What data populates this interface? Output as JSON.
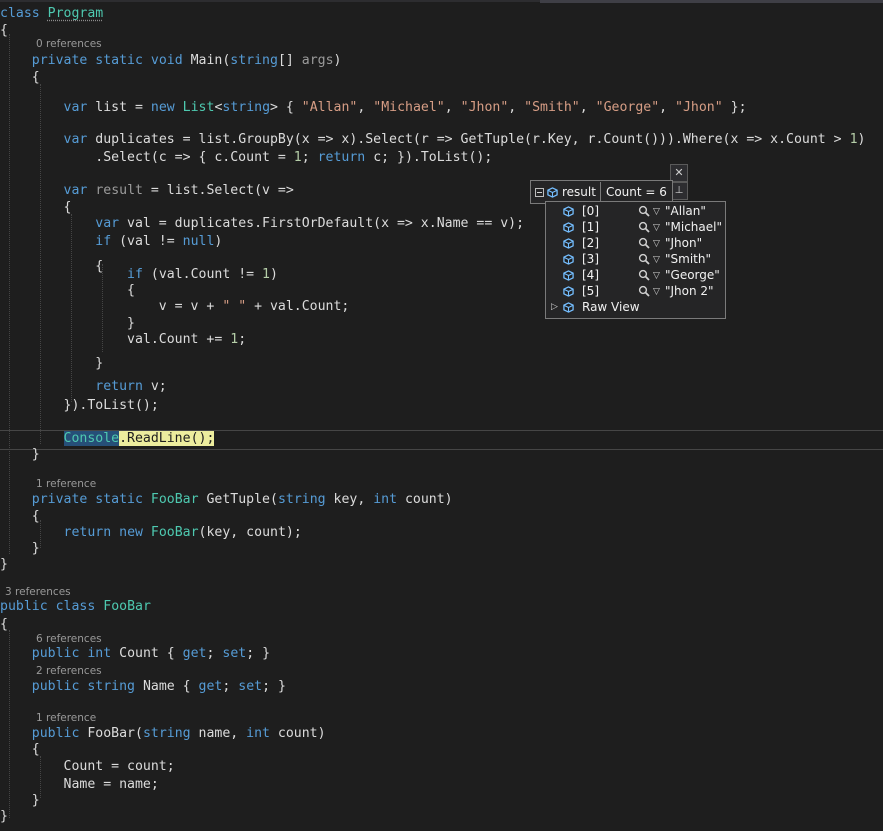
{
  "editor": {
    "lines": [
      {
        "segs": [
          [
            "kw",
            "class"
          ],
          [
            "",
            ""
          ],
          [
            "ty u-prog",
            "Program"
          ]
        ]
      },
      {
        "segs": [
          [
            "",
            "{"
          ]
        ]
      },
      {
        "segs": [
          [
            "",
            "    "
          ],
          [
            "kw",
            "private"
          ],
          [
            "",
            " "
          ],
          [
            "kw",
            "static"
          ],
          [
            "",
            " "
          ],
          [
            "kw",
            "void"
          ],
          [
            "",
            " Main("
          ],
          [
            "kw",
            "string"
          ],
          [
            "",
            "[] "
          ],
          [
            "gray",
            "args"
          ],
          [
            "",
            ")"
          ]
        ]
      },
      {
        "segs": [
          [
            "",
            "    {"
          ]
        ]
      },
      {
        "segs": [
          [
            "",
            "        "
          ],
          [
            "kw",
            "var"
          ],
          [
            "",
            " list = "
          ],
          [
            "kw",
            "new"
          ],
          [
            "",
            " "
          ],
          [
            "ty",
            "List"
          ],
          [
            "",
            "<"
          ],
          [
            "kw",
            "string"
          ],
          [
            "",
            "> { "
          ],
          [
            "st",
            "\"Allan\""
          ],
          [
            "",
            ", "
          ],
          [
            "st",
            "\"Michael\""
          ],
          [
            "",
            ", "
          ],
          [
            "st",
            "\"Jhon\""
          ],
          [
            "",
            ", "
          ],
          [
            "st",
            "\"Smith\""
          ],
          [
            "",
            ", "
          ],
          [
            "st",
            "\"George\""
          ],
          [
            "",
            ", "
          ],
          [
            "st",
            "\"Jhon\""
          ],
          [
            "",
            " };"
          ]
        ]
      },
      {
        "segs": [
          [
            "",
            "        "
          ],
          [
            "kw",
            "var"
          ],
          [
            "",
            " duplicates = list.GroupBy(x => x).Select(r => GetTuple(r.Key, r.Count())).Where(x => x.Count > "
          ],
          [
            "nu",
            "1"
          ],
          [
            "",
            ")"
          ]
        ]
      },
      {
        "segs": [
          [
            "",
            "            .Select(c => { c.Count = "
          ],
          [
            "nu",
            "1"
          ],
          [
            "",
            "; "
          ],
          [
            "kw",
            "return"
          ],
          [
            "",
            " c; }).ToList();"
          ]
        ]
      },
      {
        "segs": [
          [
            "",
            "        "
          ],
          [
            "kw",
            "var"
          ],
          [
            "",
            " "
          ],
          [
            "gray",
            "result"
          ],
          [
            "",
            " = list.Select(v =>"
          ]
        ]
      },
      {
        "segs": [
          [
            "",
            "        {"
          ]
        ]
      },
      {
        "segs": [
          [
            "",
            "            "
          ],
          [
            "kw",
            "var"
          ],
          [
            "",
            " val = duplicates.FirstOrDefault(x => x.Name == v);"
          ]
        ]
      },
      {
        "segs": [
          [
            "",
            "            "
          ],
          [
            "kw",
            "if"
          ],
          [
            "",
            " (val != "
          ],
          [
            "kw",
            "null"
          ],
          [
            "",
            ")"
          ]
        ]
      },
      {
        "segs": [
          [
            "",
            "            {"
          ]
        ]
      },
      {
        "segs": [
          [
            "",
            "                "
          ],
          [
            "kw",
            "if"
          ],
          [
            "",
            " (val.Count != "
          ],
          [
            "nu",
            "1"
          ],
          [
            "",
            ")"
          ]
        ]
      },
      {
        "segs": [
          [
            "",
            "                {"
          ]
        ]
      },
      {
        "segs": [
          [
            "",
            "                    v = v + "
          ],
          [
            "st",
            "\" \""
          ],
          [
            "",
            " + val.Count;"
          ]
        ]
      },
      {
        "segs": [
          [
            "",
            "                }"
          ]
        ]
      },
      {
        "segs": [
          [
            "",
            "                val.Count += "
          ],
          [
            "nu",
            "1"
          ],
          [
            "",
            ";"
          ]
        ]
      },
      {
        "segs": [
          [
            "",
            "            }"
          ]
        ]
      },
      {
        "segs": [
          [
            "",
            "            "
          ],
          [
            "kw",
            "return"
          ],
          [
            "",
            " v;"
          ]
        ]
      },
      {
        "segs": [
          [
            "",
            "        }).ToList();"
          ]
        ]
      },
      {
        "segs": [
          [
            "",
            "        "
          ],
          [
            "ty hl-console",
            "Console"
          ],
          [
            "hl-stmt",
            ".ReadLine();"
          ]
        ]
      },
      {
        "segs": [
          [
            "",
            "    }"
          ]
        ]
      },
      {
        "segs": [
          [
            "",
            "    "
          ],
          [
            "kw",
            "private"
          ],
          [
            "",
            " "
          ],
          [
            "kw",
            "static"
          ],
          [
            "",
            " "
          ],
          [
            "ty",
            "FooBar"
          ],
          [
            "",
            " GetTuple("
          ],
          [
            "kw",
            "string"
          ],
          [
            "",
            " key, "
          ],
          [
            "kw",
            "int"
          ],
          [
            "",
            " count)"
          ]
        ]
      },
      {
        "segs": [
          [
            "",
            "    {"
          ]
        ]
      },
      {
        "segs": [
          [
            "",
            "        "
          ],
          [
            "kw",
            "return"
          ],
          [
            "",
            " "
          ],
          [
            "kw",
            "new"
          ],
          [
            "",
            " "
          ],
          [
            "ty",
            "FooBar"
          ],
          [
            "",
            "(key, count);"
          ]
        ]
      },
      {
        "segs": [
          [
            "",
            "    }"
          ]
        ]
      },
      {
        "segs": [
          [
            "",
            "}"
          ]
        ]
      },
      {
        "segs": [
          [
            "kw",
            "public"
          ],
          [
            "",
            " "
          ],
          [
            "kw",
            "class"
          ],
          [
            "",
            " "
          ],
          [
            "ty",
            "FooBar"
          ]
        ]
      },
      {
        "segs": [
          [
            "",
            "{"
          ]
        ]
      },
      {
        "segs": [
          [
            "",
            "    "
          ],
          [
            "kw",
            "public"
          ],
          [
            "",
            " "
          ],
          [
            "kw",
            "int"
          ],
          [
            "",
            " Count { "
          ],
          [
            "kw",
            "get"
          ],
          [
            "",
            "; "
          ],
          [
            "kw",
            "set"
          ],
          [
            "",
            "; }"
          ]
        ]
      },
      {
        "segs": [
          [
            "",
            "    "
          ],
          [
            "kw",
            "public"
          ],
          [
            "",
            " "
          ],
          [
            "kw",
            "string"
          ],
          [
            "",
            " Name { "
          ],
          [
            "kw",
            "get"
          ],
          [
            "",
            "; "
          ],
          [
            "kw",
            "set"
          ],
          [
            "",
            "; }"
          ]
        ]
      },
      {
        "segs": [
          [
            "",
            "    "
          ],
          [
            "kw",
            "public"
          ],
          [
            "",
            " FooBar("
          ],
          [
            "kw",
            "string"
          ],
          [
            "",
            " name, "
          ],
          [
            "kw",
            "int"
          ],
          [
            "",
            " count)"
          ]
        ]
      },
      {
        "segs": [
          [
            "",
            "    {"
          ]
        ]
      },
      {
        "segs": [
          [
            "",
            "        Count = count;"
          ]
        ]
      },
      {
        "segs": [
          [
            "",
            "        Name = name;"
          ]
        ]
      },
      {
        "segs": [
          [
            "",
            "    }"
          ]
        ]
      },
      {
        "segs": [
          [
            "",
            "}"
          ]
        ]
      }
    ],
    "refs": [
      "0 references",
      "1 reference",
      "3 references",
      "6 references",
      "2 references",
      "1 reference"
    ]
  },
  "datatip": {
    "close_glyph": "✕",
    "pin_glyph": "⊥",
    "name": "result",
    "value": "Count = 6",
    "items": [
      {
        "index": "[0]",
        "value": "\"Allan\""
      },
      {
        "index": "[1]",
        "value": "\"Michael\""
      },
      {
        "index": "[2]",
        "value": "\"Jhon\""
      },
      {
        "index": "[3]",
        "value": "\"Smith\""
      },
      {
        "index": "[4]",
        "value": "\"George\""
      },
      {
        "index": "[5]",
        "value": "\"Jhon 2\""
      }
    ],
    "raw_view": "Raw View",
    "icons": {
      "expander": "collapse-icon",
      "item": "field-cube-icon",
      "visualizer": "magnifier-icon",
      "dropdown": "dropdown-triangle-icon",
      "raw": "expand-arrow-icon"
    },
    "colors": {
      "cube": "#75beff",
      "background": "#252526",
      "border": "#7a7a7a"
    }
  }
}
